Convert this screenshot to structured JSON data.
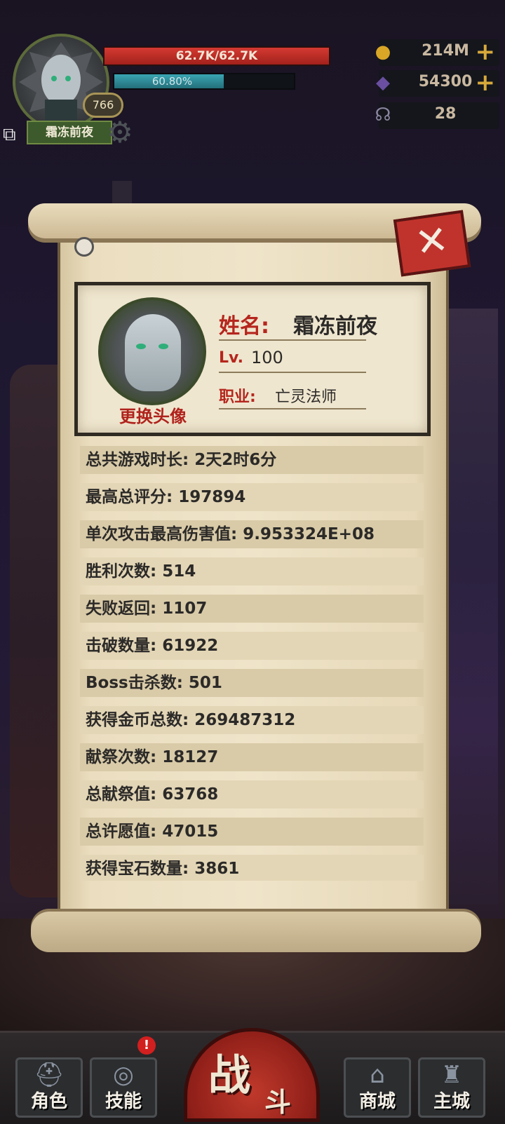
{
  "hud": {
    "hp_text": "62.7K/62.7K",
    "hp_fraction": 1.0,
    "xp_text": "60.80%",
    "xp_fraction": 0.608,
    "level": "766",
    "player_name": "霜冻前夜"
  },
  "resources": {
    "gold": {
      "value": "214M",
      "icon": "gold-coin-icon"
    },
    "gems": {
      "value": "54300",
      "icon": "crystal-icon"
    },
    "keys": {
      "value": "28",
      "icon": "horn-icon"
    }
  },
  "profile": {
    "name_label": "姓名:",
    "name_value": "霜冻前夜",
    "level_label": "Lv.",
    "level_value": "100",
    "job_label": "职业:",
    "job_value": "亡灵法师",
    "change_avatar": "更换头像"
  },
  "stats": [
    "总共游戏时长: 2天2时6分",
    "最高总评分: 197894",
    "单次攻击最高伤害值: 9.953324E+08",
    "胜利次数: 514",
    "失败返回: 1107",
    "击破数量: 61922",
    "Boss击杀数: 501",
    "获得金币总数: 269487312",
    "献祭次数: 18127",
    "总献祭值: 63768",
    "总许愿值: 47015",
    "获得宝石数量: 3861"
  ],
  "nav": {
    "role": "角色",
    "skill": "技能",
    "skill_badge": "!",
    "battle_big": "战",
    "battle_small": "斗",
    "shop": "商城",
    "city": "主城"
  },
  "colors": {
    "accent_red": "#b5261d",
    "parchment": "#efe4c9",
    "hp_red": "#d43a32",
    "xp_teal": "#3aa5b3"
  }
}
